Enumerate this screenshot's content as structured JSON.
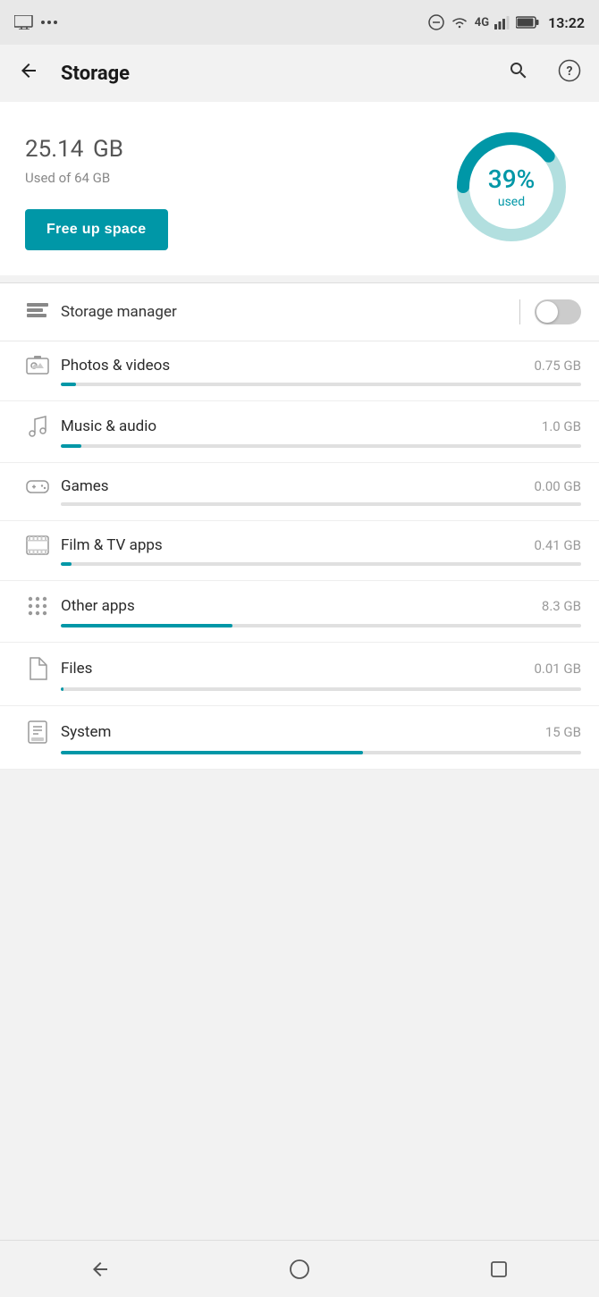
{
  "statusBar": {
    "time": "13:22",
    "icons": [
      "screen-cast",
      "more",
      "dnd",
      "wifi",
      "4g",
      "signal",
      "battery"
    ]
  },
  "appBar": {
    "title": "Storage",
    "backLabel": "←",
    "searchLabel": "🔍",
    "helpLabel": "?"
  },
  "storageSummary": {
    "usedAmount": "25.14",
    "usedUnit": "GB",
    "usedOf": "Used of 64 GB",
    "percentUsed": 39,
    "percentLabel": "39%",
    "percentSubLabel": "used",
    "freeUpLabel": "Free up space"
  },
  "storageManager": {
    "label": "Storage manager",
    "enabled": false
  },
  "categories": [
    {
      "name": "Photos & videos",
      "size": "0.75 GB",
      "fillPercent": 3,
      "iconType": "photo"
    },
    {
      "name": "Music & audio",
      "size": "1.0 GB",
      "fillPercent": 4,
      "iconType": "music"
    },
    {
      "name": "Games",
      "size": "0.00 GB",
      "fillPercent": 0,
      "iconType": "games"
    },
    {
      "name": "Film & TV apps",
      "size": "0.41 GB",
      "fillPercent": 2,
      "iconType": "film"
    },
    {
      "name": "Other apps",
      "size": "8.3 GB",
      "fillPercent": 33,
      "iconType": "apps"
    },
    {
      "name": "Files",
      "size": "0.01 GB",
      "fillPercent": 0.5,
      "iconType": "files"
    },
    {
      "name": "System",
      "size": "15 GB",
      "fillPercent": 58,
      "iconType": "system"
    }
  ],
  "navBar": {
    "backLabel": "◀",
    "homeLabel": "⬤",
    "recentLabel": "■"
  }
}
